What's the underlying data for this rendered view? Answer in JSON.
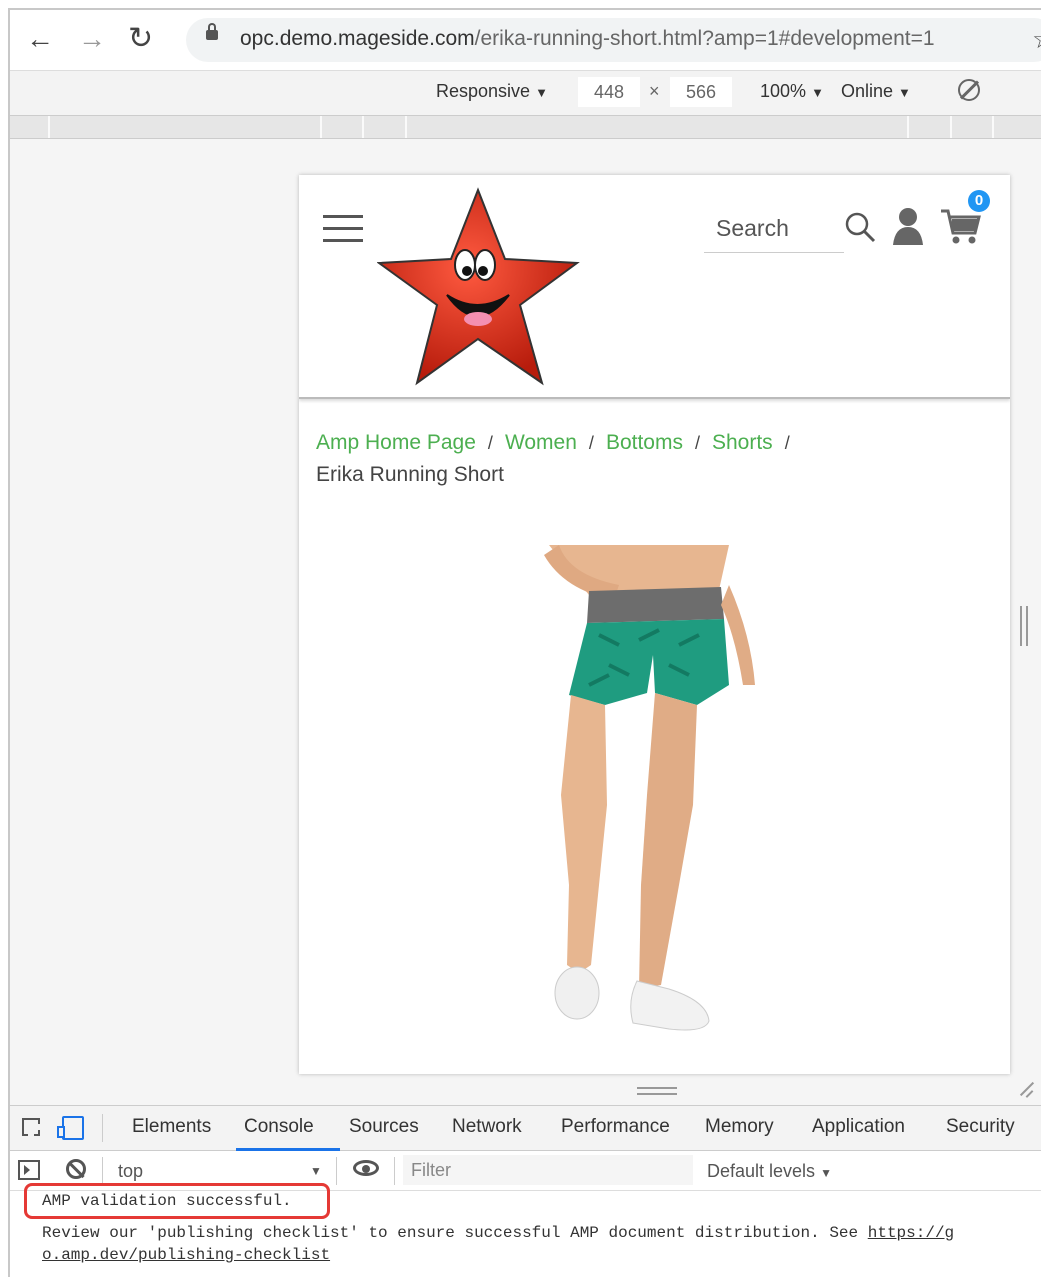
{
  "browser": {
    "url_host": "opc.demo.mageside.com",
    "url_path": "/erika-running-short.html?amp=1#development=1"
  },
  "device_toolbar": {
    "mode": "Responsive",
    "width": "448",
    "times": "×",
    "height": "566",
    "zoom": "100%",
    "network": "Online"
  },
  "site": {
    "search_placeholder": "Search",
    "cart_count": "0",
    "breadcrumb": {
      "items": [
        "Amp Home Page",
        "Women",
        "Bottoms",
        "Shorts"
      ],
      "separator": "/",
      "current": "Erika Running Short"
    }
  },
  "devtools": {
    "tabs": [
      "Elements",
      "Console",
      "Sources",
      "Network",
      "Performance",
      "Memory",
      "Application",
      "Security"
    ],
    "active_tab": "Console",
    "context": "top",
    "filter_placeholder": "Filter",
    "levels": "Default levels",
    "messages": {
      "validation": "AMP validation successful.",
      "review_line1": "Review our 'publishing checklist' to ensure successful AMP document distribution. See ",
      "review_link_part1": "https://g",
      "review_link_part2": "o.amp.dev/publishing-checklist"
    }
  },
  "colors": {
    "breadcrumb_link": "#4caf50",
    "accent": "#1a73e8",
    "cart_badge": "#2196f3",
    "highlight": "#e53935",
    "logo_star": "#d32f1e",
    "shorts": "#1f9c80"
  }
}
